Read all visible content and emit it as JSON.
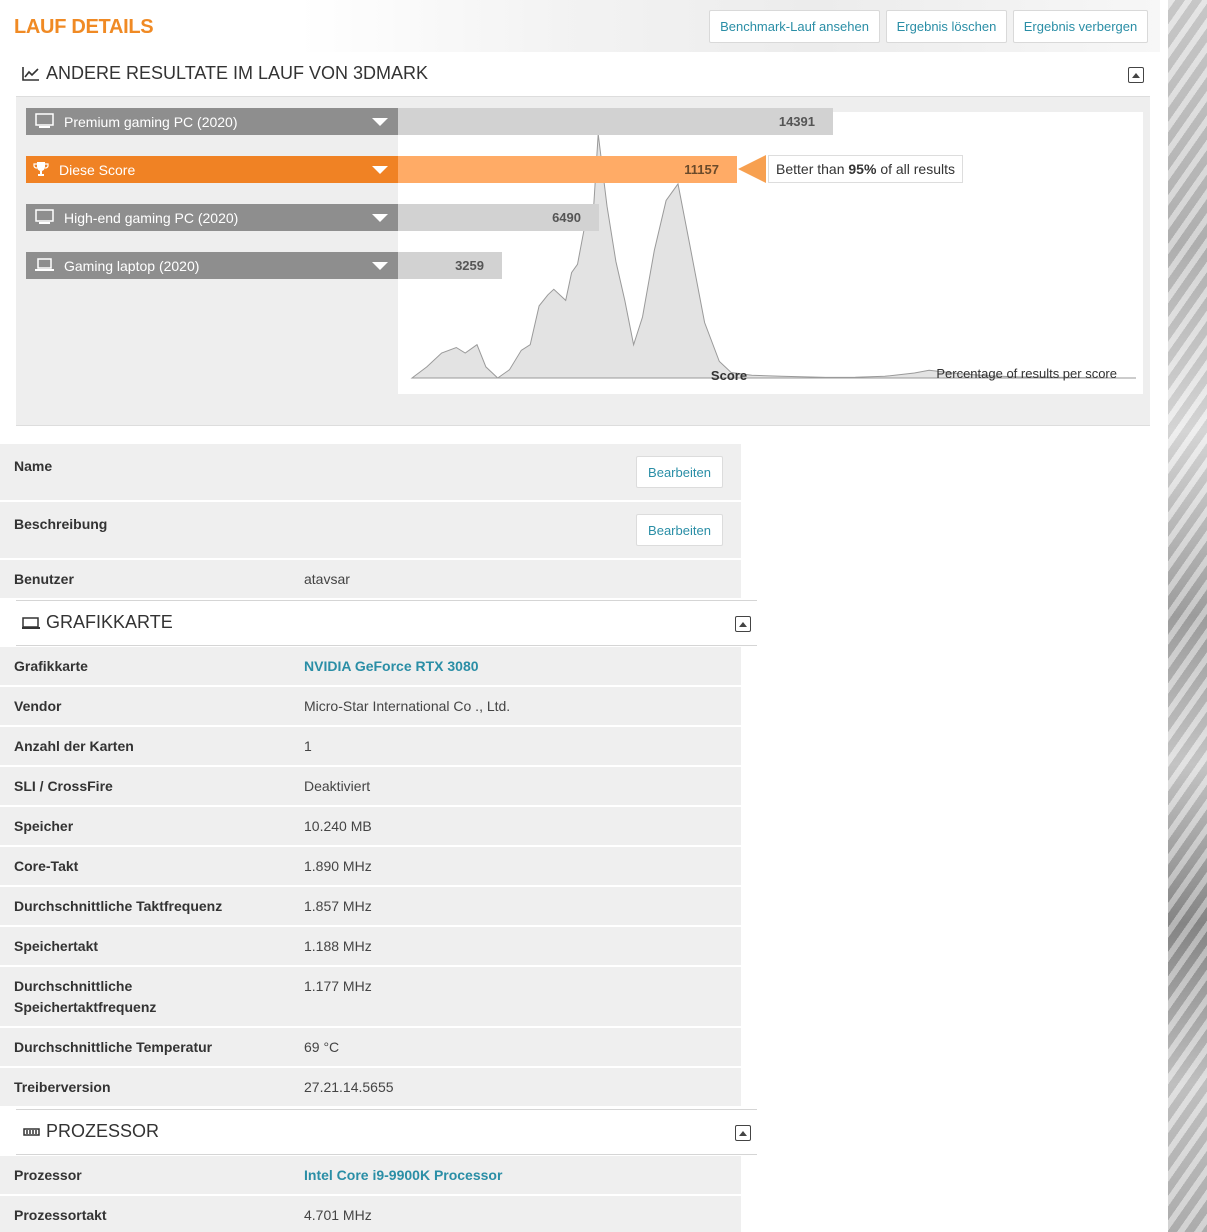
{
  "page": {
    "title": "LAUF DETAILS",
    "buttons": [
      "Benchmark-Lauf ansehen",
      "Ergebnis löschen",
      "Ergebnis verbergen"
    ]
  },
  "compare": {
    "header": "ANDERE RESULTATE IM LAUF VON 3DMARK",
    "rows": [
      {
        "label": "Premium gaming PC (2020)",
        "value": "14391",
        "icon": "desktop-icon",
        "highlight": false
      },
      {
        "label": "Diese Score",
        "value": "11157",
        "icon": "trophy-icon",
        "highlight": true
      },
      {
        "label": "High-end gaming PC (2020)",
        "value": "6490",
        "icon": "desktop-icon",
        "highlight": false
      },
      {
        "label": "Gaming laptop (2020)",
        "value": "3259",
        "icon": "laptop-icon",
        "highlight": false
      }
    ],
    "tooltip_prefix": "Better than ",
    "tooltip_value": "95%",
    "tooltip_suffix": " of all results",
    "colors": {
      "accent": "#f08224",
      "accent_light": "#ffab66",
      "link": "#2a8ea6",
      "title": "#f08a24"
    }
  },
  "chart_data": {
    "type": "area",
    "xlabel": "Score",
    "ylabel": "Percentage of results per score",
    "xlim": [
      0,
      24500
    ],
    "x_ticks": [
      "2000",
      "4000",
      "6000",
      "8000",
      "10000",
      "12000",
      "14000",
      "16000",
      "18000",
      "20000",
      "22000",
      "24000"
    ],
    "series": [
      {
        "x": [
          0,
          500,
          1000,
          1500,
          1800,
          2200,
          2500,
          2900,
          3300,
          3700,
          4000,
          4300,
          4600,
          4800,
          5200,
          5400,
          5600,
          5900,
          6100,
          6300,
          6600,
          6900,
          7200,
          7500,
          7800,
          8200,
          8600,
          9000,
          9400,
          9900,
          10400,
          10800,
          11500,
          12500,
          14000,
          15000,
          16000,
          17000,
          17500,
          18500,
          19500,
          20500,
          22000,
          23000,
          24000,
          24500
        ],
        "y": [
          0,
          4,
          9,
          11,
          9,
          12,
          4,
          0,
          3,
          10,
          12,
          26,
          30,
          32,
          28,
          38,
          41,
          58,
          54,
          88,
          62,
          42,
          28,
          12,
          22,
          46,
          64,
          70,
          48,
          20,
          6,
          2,
          1,
          0.6,
          0.2,
          0.3,
          0.6,
          1.8,
          2.8,
          1.6,
          0.8,
          0.4,
          0.2,
          0.1,
          0,
          0
        ]
      }
    ]
  },
  "info_rows": [
    {
      "key": "Name",
      "edit": "Bearbeiten"
    },
    {
      "key": "Beschreibung",
      "edit": "Bearbeiten"
    },
    {
      "key": "Benutzer",
      "value": "atavsar"
    }
  ],
  "gpu": {
    "header": "GRAFIKKARTE",
    "rows": [
      {
        "key": "Grafikkarte",
        "value": "NVIDIA GeForce RTX 3080",
        "link": true
      },
      {
        "key": "Vendor",
        "value": "Micro-Star International Co ., Ltd."
      },
      {
        "key": "Anzahl der Karten",
        "value": "1"
      },
      {
        "key": "SLI / CrossFire",
        "value": "Deaktiviert"
      },
      {
        "key": "Speicher",
        "value": "10.240 MB"
      },
      {
        "key": "Core-Takt",
        "value": "1.890 MHz"
      },
      {
        "key": "Durchschnittliche Taktfrequenz",
        "value": "1.857 MHz"
      },
      {
        "key": "Speichertakt",
        "value": "1.188 MHz"
      },
      {
        "key": "Durchschnittliche",
        "key2": "Speichertaktfrequenz",
        "value": "1.177 MHz"
      },
      {
        "key": "Durchschnittliche Temperatur",
        "value": "69 °C"
      },
      {
        "key": "Treiberversion",
        "value": "27.21.14.5655"
      }
    ]
  },
  "cpu": {
    "header": "PROZESSOR",
    "rows": [
      {
        "key": "Prozessor",
        "value": "Intel Core i9-9900K Processor",
        "link": true
      },
      {
        "key": "Prozessortakt",
        "value": "4.701 MHz"
      }
    ]
  }
}
